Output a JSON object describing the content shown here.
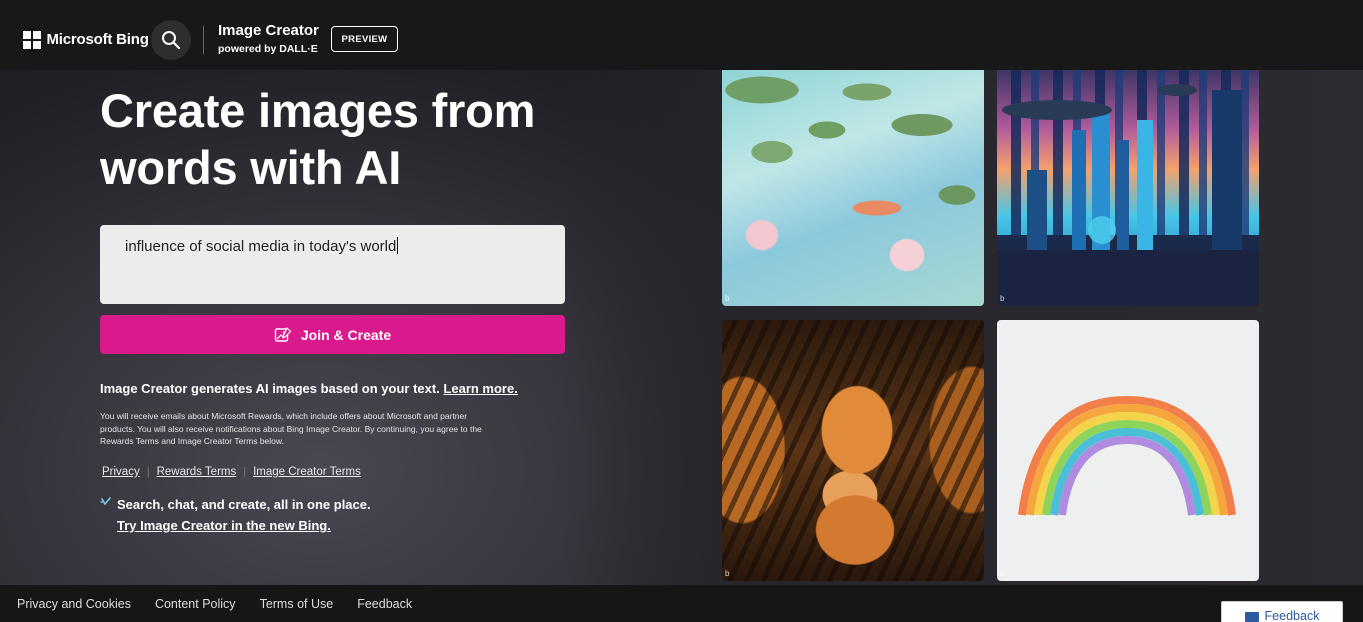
{
  "header": {
    "logo_text": "Microsoft Bing",
    "brand_title": "Image Creator",
    "brand_subtitle": "powered by DALL·E",
    "preview_badge": "PREVIEW"
  },
  "hero": {
    "title": "Create images from words with AI"
  },
  "prompt": {
    "value": "influence of social media in today's world"
  },
  "create_button": {
    "label": "Join & Create"
  },
  "info": {
    "main_text": "Image Creator generates AI images based on your text.",
    "learn_more": "Learn more.",
    "fine_print": "You will receive emails about Microsoft Rewards, which include offers about Microsoft and partner products. You will also receive notifications about Bing Image Creator. By continuing, you agree to the Rewards Terms and Image Creator Terms below."
  },
  "terms_links": [
    {
      "label": "Privacy"
    },
    {
      "label": "Rewards Terms"
    },
    {
      "label": "Image Creator Terms"
    }
  ],
  "promo": {
    "line1": "Search, chat, and create, all in one place.",
    "line2": "Try Image Creator in the new Bing."
  },
  "gallery": [
    {
      "name": "koi-pond-image",
      "watermark": "b"
    },
    {
      "name": "futuristic-city-image",
      "watermark": "b"
    },
    {
      "name": "tiger-dolls-image",
      "watermark": "b"
    },
    {
      "name": "paper-rainbow-image",
      "watermark": "b"
    }
  ],
  "footer": {
    "links": [
      {
        "label": "Privacy and Cookies"
      },
      {
        "label": "Content Policy"
      },
      {
        "label": "Terms of Use"
      },
      {
        "label": "Feedback"
      }
    ],
    "feedback_button": "Feedback"
  },
  "colors": {
    "accent_pink": "#d9198c",
    "header_bg": "#181818",
    "feedback_blue": "#2c5aa0"
  }
}
